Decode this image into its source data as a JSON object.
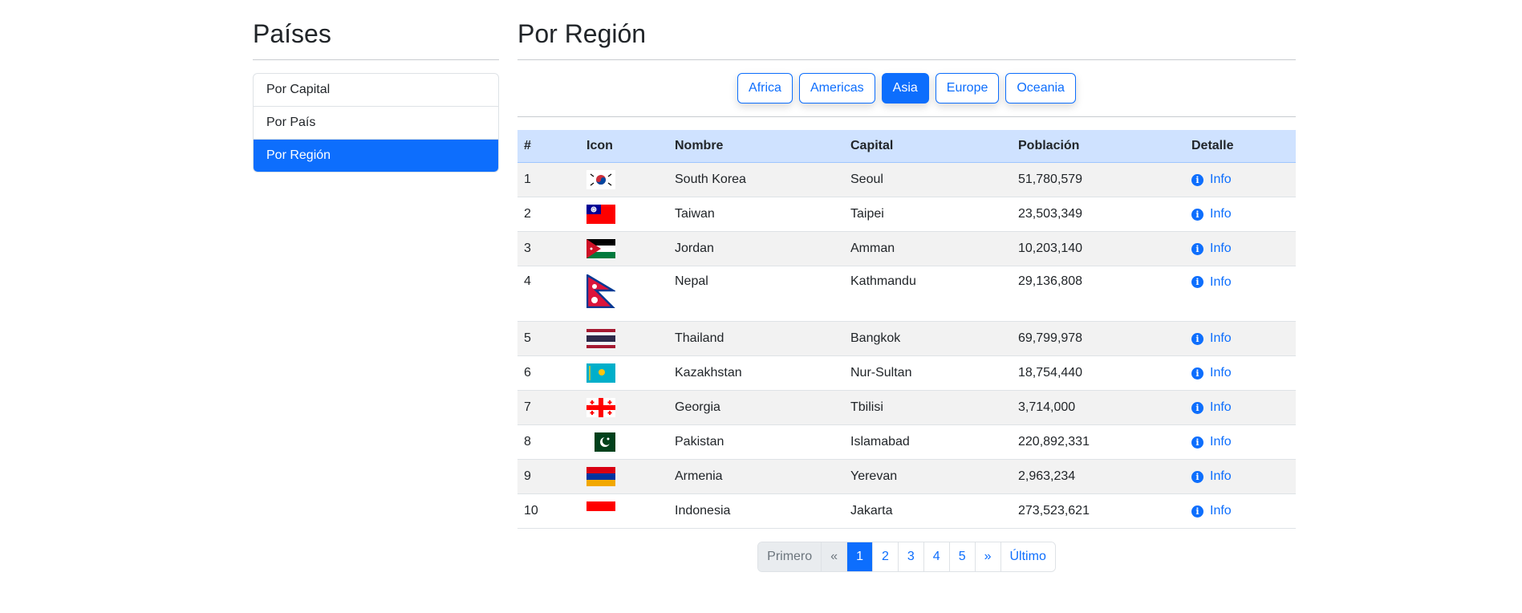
{
  "sidebar": {
    "title": "Países",
    "items": [
      {
        "label": "Por Capital",
        "active": false
      },
      {
        "label": "Por País",
        "active": false
      },
      {
        "label": "Por Región",
        "active": true
      }
    ]
  },
  "main": {
    "title": "Por Región",
    "regions": [
      {
        "label": "Africa",
        "active": false
      },
      {
        "label": "Americas",
        "active": false
      },
      {
        "label": "Asia",
        "active": true
      },
      {
        "label": "Europe",
        "active": false
      },
      {
        "label": "Oceania",
        "active": false
      }
    ],
    "table": {
      "headers": [
        "#",
        "Icon",
        "Nombre",
        "Capital",
        "Población",
        "Detalle"
      ],
      "info_label": "Info",
      "rows": [
        {
          "num": "1",
          "flag": "south-korea-flag",
          "name": "South Korea",
          "capital": "Seoul",
          "population": "51,780,579"
        },
        {
          "num": "2",
          "flag": "taiwan-flag",
          "name": "Taiwan",
          "capital": "Taipei",
          "population": "23,503,349"
        },
        {
          "num": "3",
          "flag": "jordan-flag",
          "name": "Jordan",
          "capital": "Amman",
          "population": "10,203,140"
        },
        {
          "num": "4",
          "flag": "nepal-flag",
          "name": "Nepal",
          "capital": "Kathmandu",
          "population": "29,136,808"
        },
        {
          "num": "5",
          "flag": "thailand-flag",
          "name": "Thailand",
          "capital": "Bangkok",
          "population": "69,799,978"
        },
        {
          "num": "6",
          "flag": "kazakhstan-flag",
          "name": "Kazakhstan",
          "capital": "Nur-Sultan",
          "population": "18,754,440"
        },
        {
          "num": "7",
          "flag": "georgia-flag",
          "name": "Georgia",
          "capital": "Tbilisi",
          "population": "3,714,000"
        },
        {
          "num": "8",
          "flag": "pakistan-flag",
          "name": "Pakistan",
          "capital": "Islamabad",
          "population": "220,892,331"
        },
        {
          "num": "9",
          "flag": "armenia-flag",
          "name": "Armenia",
          "capital": "Yerevan",
          "population": "2,963,234"
        },
        {
          "num": "10",
          "flag": "indonesia-flag",
          "name": "Indonesia",
          "capital": "Jakarta",
          "population": "273,523,621"
        }
      ]
    },
    "pagination": {
      "first": "Primero",
      "prev": "«",
      "pages": [
        "1",
        "2",
        "3",
        "4",
        "5"
      ],
      "current": "1",
      "next": "»",
      "last": "Último"
    }
  },
  "colors": {
    "primary": "#0d6efd",
    "table_header_bg": "#cfe2ff",
    "stripe_bg": "#f2f2f2"
  }
}
